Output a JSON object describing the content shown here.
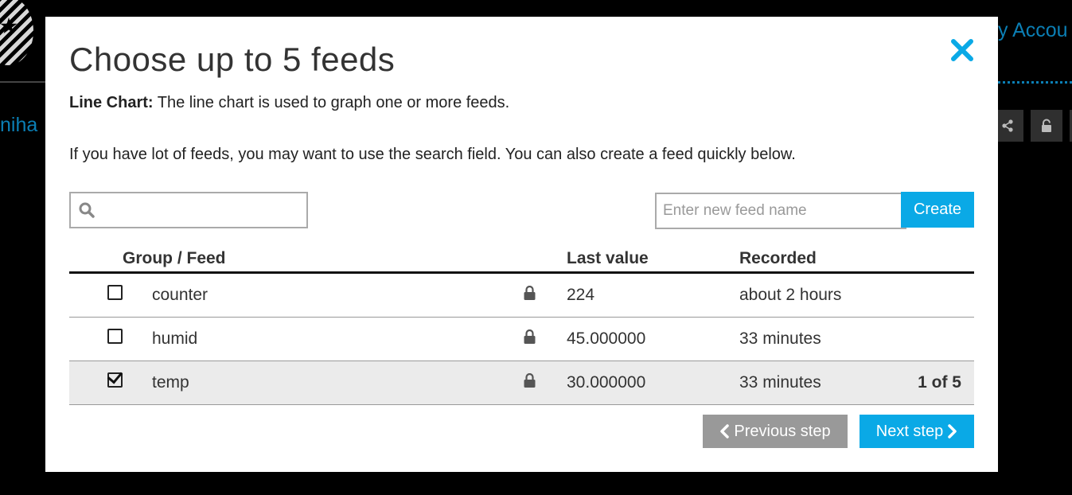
{
  "background": {
    "account_link": "y Accou",
    "partial_text": "niha"
  },
  "modal": {
    "title": "Choose up to 5 feeds",
    "desc_label": "Line Chart:",
    "desc_text": " The line chart is used to graph one or more feeds.",
    "hint": "If you have lot of feeds, you may want to use the search field. You can also create a feed quickly below.",
    "search": {
      "value": "",
      "placeholder": ""
    },
    "new_feed": {
      "placeholder": "Enter new feed name",
      "value": ""
    },
    "create_label": "Create",
    "table": {
      "headers": {
        "feed": "Group / Feed",
        "value": "Last value",
        "recorded": "Recorded"
      },
      "rows": [
        {
          "name": "counter",
          "checked": false,
          "last_value": "224",
          "recorded": "about 2 hours"
        },
        {
          "name": "humid",
          "checked": false,
          "last_value": "45.000000",
          "recorded": "33 minutes"
        },
        {
          "name": "temp",
          "checked": true,
          "last_value": "30.000000",
          "recorded": "33 minutes",
          "count": "1 of 5"
        }
      ]
    },
    "prev_label": "Previous step",
    "next_label": "Next step"
  },
  "colors": {
    "accent": "#0aa9e6",
    "secondary": "#999999"
  },
  "icons": [
    "close-icon",
    "search-icon",
    "lock-icon",
    "chevron-left-icon",
    "chevron-right-icon",
    "share-icon",
    "unlock-icon"
  ]
}
